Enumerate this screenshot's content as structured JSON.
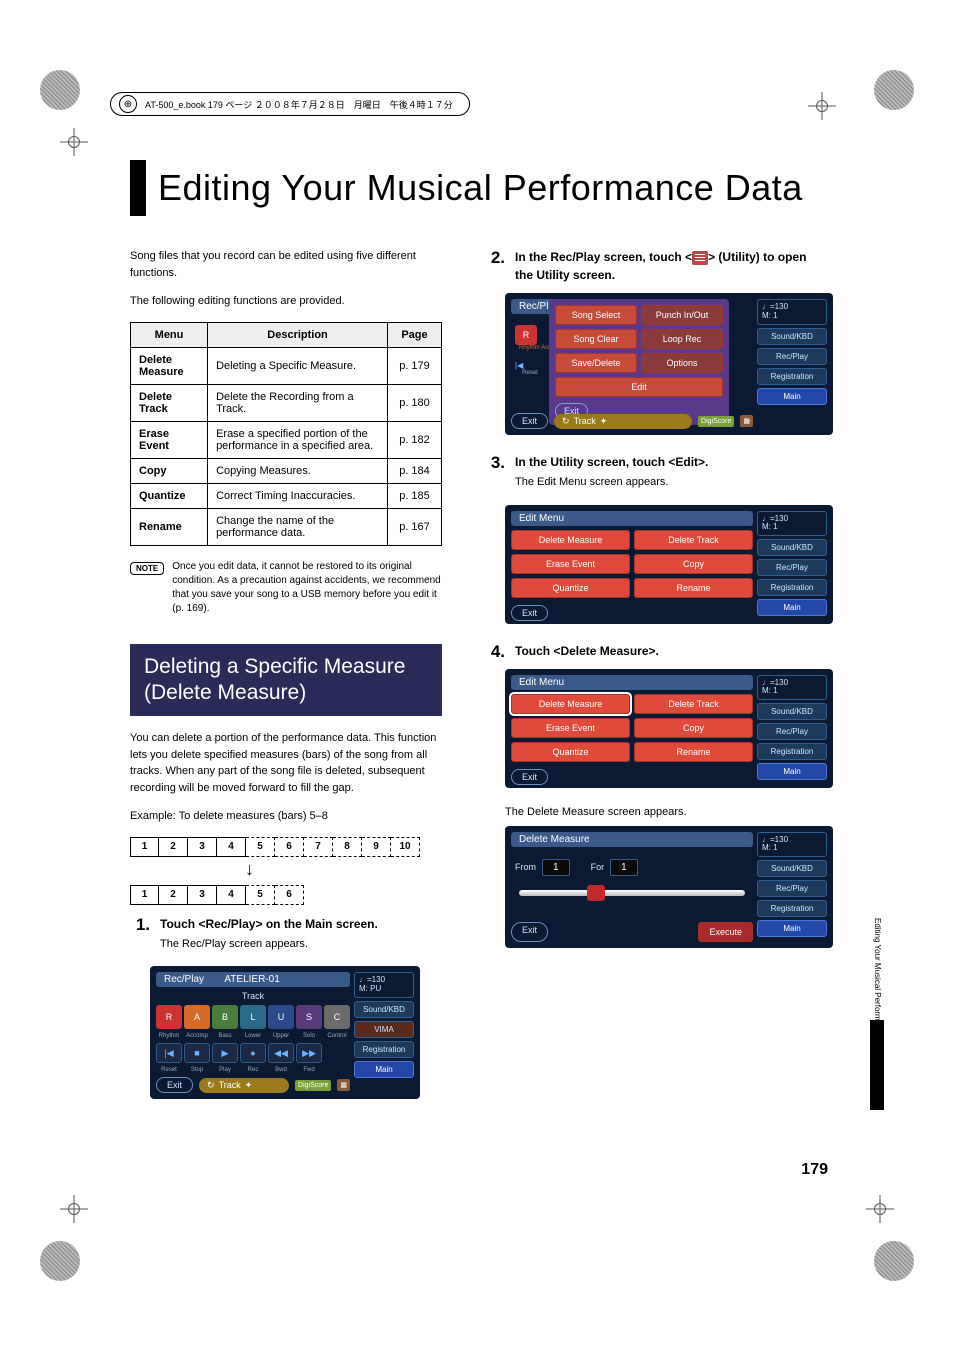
{
  "print_header": "AT-500_e.book  179 ページ  ２００８年７月２８日　月曜日　午後４時１７分",
  "title": "Editing Your Musical Performance Data",
  "intro1": "Song files that you record can be edited using five different functions.",
  "intro2": "The following editing functions are provided.",
  "table": {
    "headers": [
      "Menu",
      "Description",
      "Page"
    ],
    "rows": [
      [
        "Delete Measure",
        "Deleting a Specific Measure.",
        "p. 179"
      ],
      [
        "Delete Track",
        "Delete the Recording from a Track.",
        "p. 180"
      ],
      [
        "Erase Event",
        "Erase a specified portion of the performance in a specified area.",
        "p. 182"
      ],
      [
        "Copy",
        "Copying Measures.",
        "p. 184"
      ],
      [
        "Quantize",
        "Correct Timing Inaccuracies.",
        "p. 185"
      ],
      [
        "Rename",
        "Change the name of the performance data.",
        "p. 167"
      ]
    ]
  },
  "note_label": "NOTE",
  "note_text": "Once you edit data, it cannot be restored to its original condition. As a precaution against accidents, we recommend that you save your song to a USB memory before you edit it (p. 169).",
  "section_header": "Deleting a Specific Measure (Delete Measure)",
  "section_para": "You can delete a portion of the performance data. This function lets you delete specified measures (bars) of the song from all tracks. When any part of the song file is deleted, subsequent recording will be moved forward to fill the gap.",
  "example_line": "Example: To delete measures (bars) 5–8",
  "measures_top": [
    "1",
    "2",
    "3",
    "4",
    "5",
    "6",
    "7",
    "8",
    "9",
    "10"
  ],
  "measures_bottom": [
    "1",
    "2",
    "3",
    "4",
    "5",
    "6"
  ],
  "steps": {
    "s1": {
      "num": "1.",
      "instr": "Touch <Rec/Play> on the Main screen.",
      "sub": "The Rec/Play screen appears."
    },
    "s2": {
      "num": "2.",
      "instr_a": "In the Rec/Play screen, touch <",
      "instr_b": "> (Utility) to open the Utility screen."
    },
    "s3": {
      "num": "3.",
      "instr": "In the Utility screen, touch <Edit>.",
      "sub": "The Edit Menu screen appears."
    },
    "s4": {
      "num": "4.",
      "instr": "Touch <Delete Measure>.",
      "sub": "The Delete Measure screen appears."
    }
  },
  "dev": {
    "tempo": "♩=130",
    "meas": "M:    1",
    "meas_pu": "M:  PU",
    "side": {
      "sound": "Sound/KBD",
      "rec": "Rec/Play",
      "reg": "Registration",
      "main": "Main",
      "vima": "VIMA"
    },
    "recplay": {
      "title": "Rec/Play",
      "song": "ATELIER-01",
      "track": "Track",
      "cols": [
        "R",
        "A",
        "B",
        "L",
        "U",
        "S",
        "C"
      ],
      "labels": [
        "Rhythm",
        "Accomp",
        "Bass",
        "Lower",
        "Upper",
        "Solo",
        "Control"
      ],
      "trans": [
        "|◀",
        "■",
        "▶",
        "●",
        "◀◀",
        "▶▶"
      ],
      "tlabels": [
        "Reset",
        "Stop",
        "Play",
        "Rec",
        "Bwd",
        "Fwd"
      ],
      "exit": "Exit",
      "trackbtn": "Track",
      "digi": "DigiScore"
    },
    "util_popup": {
      "bar": "Rec/Pl",
      "items": [
        "Song Select",
        "Punch In/Out",
        "Song Clear",
        "Loop Rec",
        "Save/Delete",
        "Options",
        "Edit"
      ],
      "exit": "Exit",
      "rhythm": "Rhythm Acc",
      "reset": "Reset"
    },
    "editmenu": {
      "title": "Edit Menu",
      "items": [
        "Delete Measure",
        "Delete Track",
        "Erase Event",
        "Copy",
        "Quantize",
        "Rename"
      ],
      "exit": "Exit"
    },
    "delmeasure": {
      "title": "Delete Measure",
      "from": "From",
      "for": "For",
      "val": "1",
      "exit": "Exit",
      "exec": "Execute"
    }
  },
  "side_text": "Editing Your Musical Performance Data",
  "page_number": "179"
}
